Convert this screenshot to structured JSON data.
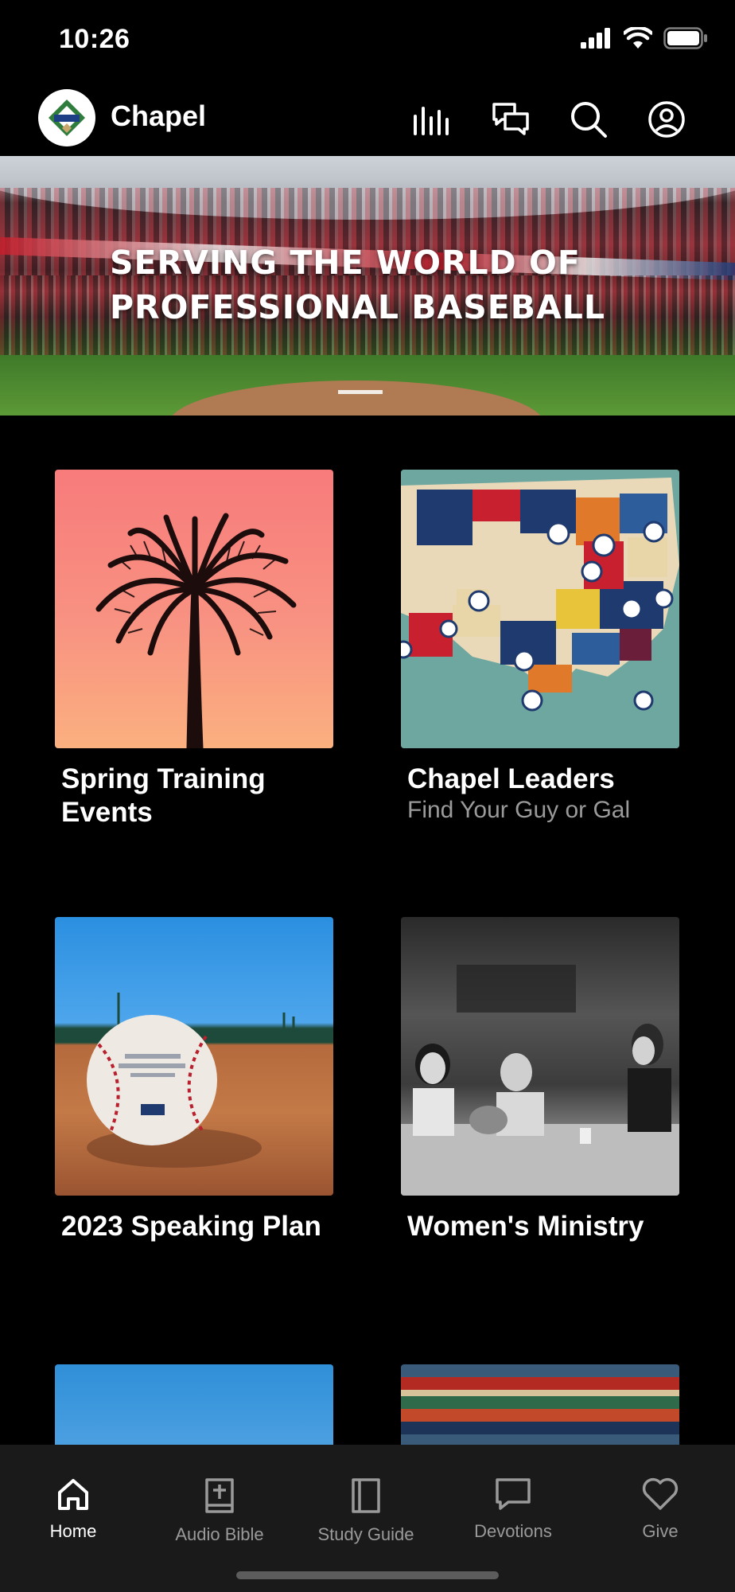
{
  "status_bar": {
    "time": "10:26"
  },
  "header": {
    "title": "Chapel"
  },
  "hero": {
    "title": "SERVING THE WORLD OF PROFESSIONAL BASEBALL"
  },
  "tiles": [
    {
      "title": "Spring Training Events",
      "subtitle": ""
    },
    {
      "title": "Chapel Leaders",
      "subtitle": "Find Your Guy or Gal"
    },
    {
      "title": "2023 Speaking Plan",
      "subtitle": ""
    },
    {
      "title": "Women's Ministry",
      "subtitle": ""
    }
  ],
  "tab_bar": {
    "items": [
      {
        "label": "Home",
        "icon": "home-icon",
        "active": true
      },
      {
        "label": "Audio Bible",
        "icon": "book-plus-icon",
        "active": false
      },
      {
        "label": "Study Guide",
        "icon": "book-icon",
        "active": false
      },
      {
        "label": "Devotions",
        "icon": "chat-bubble-icon",
        "active": false
      },
      {
        "label": "Give",
        "icon": "heart-icon",
        "active": false
      }
    ]
  },
  "colors": {
    "background": "#000000",
    "tab_bar": "#1a1a1a",
    "inactive_text": "#9a9a9a",
    "active_text": "#ffffff"
  }
}
